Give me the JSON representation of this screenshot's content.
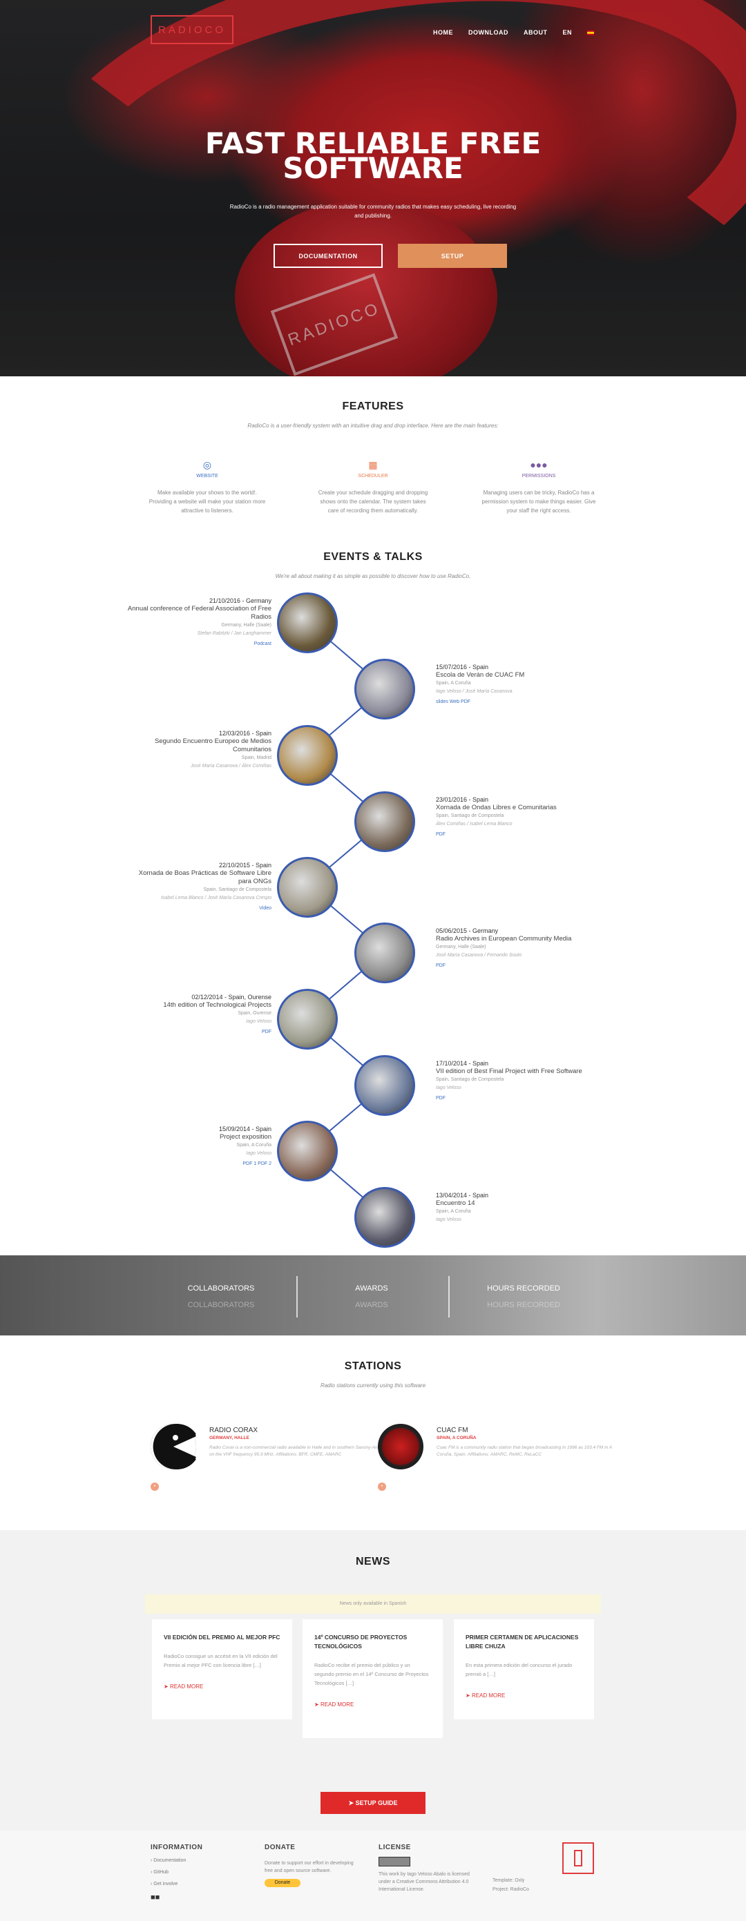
{
  "header": {
    "logo": "RADIOCO",
    "nav": [
      "HOME",
      "DOWNLOAD",
      "ABOUT",
      "EN"
    ],
    "title_line1": "FAST RELIABLE FREE",
    "title_line2": "SOFTWARE",
    "subtitle": "RadioCo is a radio management application suitable for community radios that makes easy scheduling, live recording and publishing.",
    "btn_documentation": "DOCUMENTATION",
    "btn_setup": "SETUP"
  },
  "features": {
    "title": "FEATURES",
    "subtitle": "RadioCo is a user-friendly system with an intuitive drag and drop interface. Here are the main features:",
    "items": [
      {
        "label": "WEBSITE",
        "icon": "globe-icon",
        "color": "#3a6fc0",
        "desc": "Make available your shows to the world!. Providing a website will make your station more attractive to listeners."
      },
      {
        "label": "SCHEDULER",
        "icon": "calendar-icon",
        "color": "#e8784a",
        "desc": "Create your schedule dragging and dropping shows onto the calendar. The system takes care of recording them automatically."
      },
      {
        "label": "PERMISSIONS",
        "icon": "users-icon",
        "color": "#7a5aa0",
        "desc": "Managing users can be tricky, RadioCo has a permission system to make things easier. Give your staff the right access."
      }
    ]
  },
  "events": {
    "title": "EVENTS & TALKS",
    "subtitle": "We're all about making it as simple as possible to discover how to use RadioCo.",
    "items": [
      {
        "date": "21/10/2016 - Germany",
        "name": "Annual conference of Federal Association of Free Radios",
        "place": "Germany, Halle (Saale)",
        "people": "Stefan Rabitzki / Jan Langhammer",
        "links": "Podcast"
      },
      {
        "date": "15/07/2016 - Spain",
        "name": "Escola de Verán de CUAC FM",
        "place": "Spain, A Coruña",
        "people": "Iago Veloso / José María Casanova",
        "links": "slides   Web   PDF"
      },
      {
        "date": "12/03/2016 - Spain",
        "name": "Segundo Encuentro Europeo de Medios Comunitarios",
        "place": "Spain, Madrid",
        "people": "José María Casanova / Álex Comiñas",
        "links": ""
      },
      {
        "date": "23/01/2016 - Spain",
        "name": "Xornada de Ondas Libres e Comunitarias",
        "place": "Spain, Santiago de Compostela",
        "people": "Álex Comiñas / Isabel Lema Blanco",
        "links": "PDF"
      },
      {
        "date": "22/10/2015 - Spain",
        "name": "Xornada de Boas Prácticas de Software Libre para ONGs",
        "place": "Spain, Santiago de Compostela",
        "people": "Isabel Lema Blanco / José María Casanova Crespo",
        "links": "Video"
      },
      {
        "date": "05/06/2015 - Germany",
        "name": "Radio Archives in European Community Media",
        "place": "Germany, Halle (Saale)",
        "people": "José María Casanova / Fernando Souto",
        "links": "PDF"
      },
      {
        "date": "02/12/2014 - Spain, Ourense",
        "name": "14th edition of Technological Projects",
        "place": "Spain, Ourense",
        "people": "Iago Veloso",
        "links": "PDF"
      },
      {
        "date": "17/10/2014 - Spain",
        "name": "VII edition of Best Final Project with Free Software",
        "place": "Spain, Santiago de Compostela",
        "people": "Iago Veloso",
        "links": "PDF"
      },
      {
        "date": "15/09/2014 - Spain",
        "name": "Project exposition",
        "place": "Spain, A Coruña",
        "people": "Iago Veloso",
        "links": "PDF 1   PDF 2"
      },
      {
        "date": "13/04/2014 - Spain",
        "name": "Encuentro 14",
        "place": "Spain, A Coruña",
        "people": "Iago Veloso",
        "links": ""
      }
    ]
  },
  "stats": {
    "collaborators": "COLLABORATORS",
    "awards": "AWARDS",
    "hours": "HOURS RECORDED"
  },
  "stations": {
    "title": "STATIONS",
    "subtitle": "Radio stations currently using this software",
    "items": [
      {
        "name": "RADIO CORAX",
        "location": "GERMANY, HALLE",
        "desc": "Radio Corax is a non-commercial radio available in Halle and in southern Saxony-Anhalt on the VHF frequency 95.9 MHz. Affiliations: BFR, CMFE, AMARC"
      },
      {
        "name": "CUAC FM",
        "location": "SPAIN, A CORUÑA",
        "desc": "Cuac FM is a community radio station that began broadcasting in 1996 as 103.4 FM in A Coruña, Spain. Affiliations: AMARC, ReMC, ReLaCC"
      }
    ]
  },
  "news": {
    "title": "NEWS",
    "notice": "News only available in Spanish",
    "items": [
      {
        "title": "VII EDICIÓN DEL PREMIO AL MEJOR PFC",
        "text": "RadioCo consigue un accésit en la VII edición del Premio al mejor PFC con licencia libre […]",
        "more": "READ MORE"
      },
      {
        "title": "14º CONCURSO DE PROYECTOS TECNOLÓGICOS",
        "text": "RadioCo recibe el premio del público y un segundo premio en el 14º Concurso de Proyectos Tecnológicos […]",
        "more": "READ MORE"
      },
      {
        "title": "PRIMER CERTAMEN DE APLICACIONES LIBRE CHUZA",
        "text": "En esta primera edición del concurso el jurado premió a […]",
        "more": "READ MORE"
      }
    ],
    "setup_guide": "SETUP GUIDE"
  },
  "footer": {
    "information": "INFORMATION",
    "info_links": [
      "Documentation",
      "GitHub",
      "Get involve"
    ],
    "donate": "DONATE",
    "donate_text": "Donate to support our effort in developing free and open source software.",
    "donate_btn": "Donate",
    "license": "LICENSE",
    "license_text": "This work by Iago Veloso Abalo is licensed under a Creative Commons Attribution 4.0 International License.",
    "template": "Template: Oxly",
    "project": "Project: RadioCo"
  }
}
